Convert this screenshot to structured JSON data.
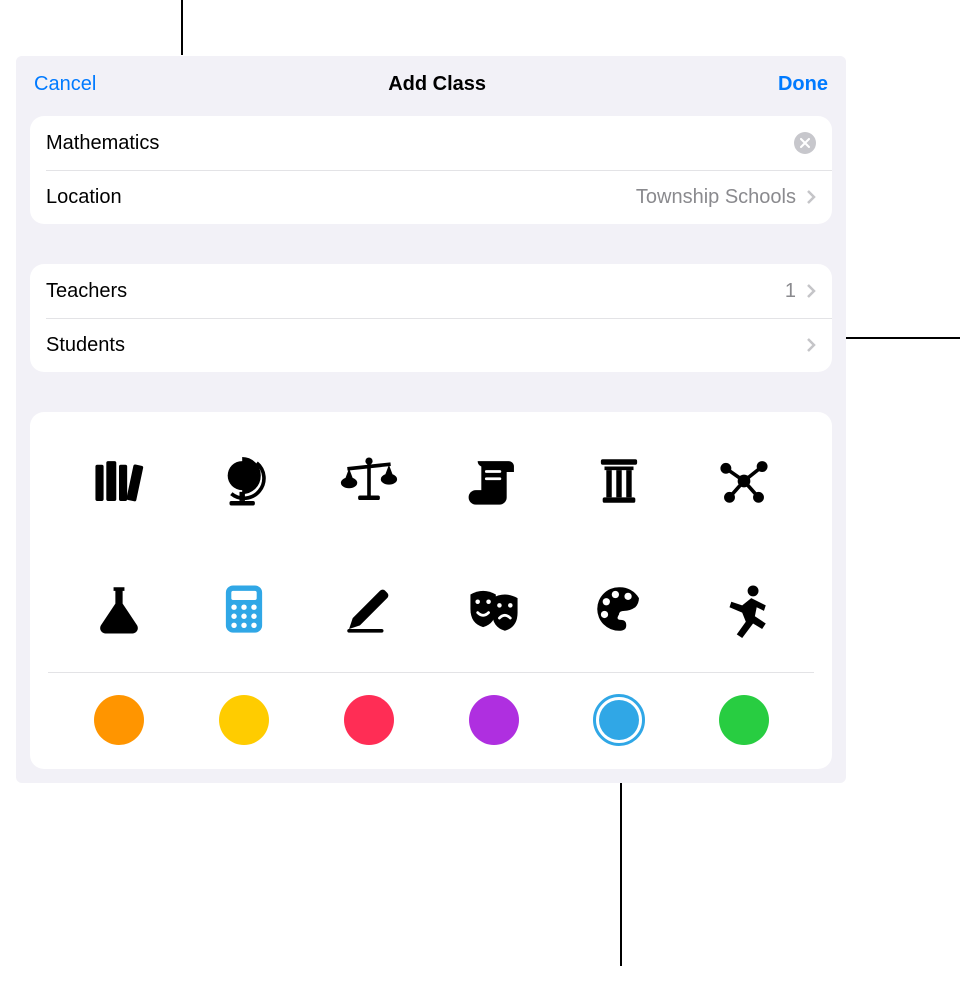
{
  "nav": {
    "cancel": "Cancel",
    "title": "Add Class",
    "done": "Done"
  },
  "fields": {
    "name_value": "Mathematics",
    "location_label": "Location",
    "location_value": "Township Schools"
  },
  "people": {
    "teachers_label": "Teachers",
    "teachers_count": "1",
    "students_label": "Students",
    "students_count": ""
  },
  "icons": [
    {
      "id": "books-icon",
      "selected": false
    },
    {
      "id": "globe-icon",
      "selected": false
    },
    {
      "id": "scales-icon",
      "selected": false
    },
    {
      "id": "scroll-icon",
      "selected": false
    },
    {
      "id": "column-icon",
      "selected": false
    },
    {
      "id": "molecule-icon",
      "selected": false
    },
    {
      "id": "flask-icon",
      "selected": false
    },
    {
      "id": "calculator-icon",
      "selected": true
    },
    {
      "id": "pencil-icon",
      "selected": false
    },
    {
      "id": "masks-icon",
      "selected": false
    },
    {
      "id": "palette-icon",
      "selected": false
    },
    {
      "id": "runner-icon",
      "selected": false
    }
  ],
  "colors": [
    {
      "id": "orange",
      "hex": "#ff9500",
      "selected": false
    },
    {
      "id": "yellow",
      "hex": "#ffcc00",
      "selected": false
    },
    {
      "id": "pink",
      "hex": "#ff2d55",
      "selected": false
    },
    {
      "id": "purple",
      "hex": "#af2fe0",
      "selected": false
    },
    {
      "id": "blue",
      "hex": "#30a7e6",
      "selected": true
    },
    {
      "id": "green",
      "hex": "#28cd41",
      "selected": false
    }
  ]
}
